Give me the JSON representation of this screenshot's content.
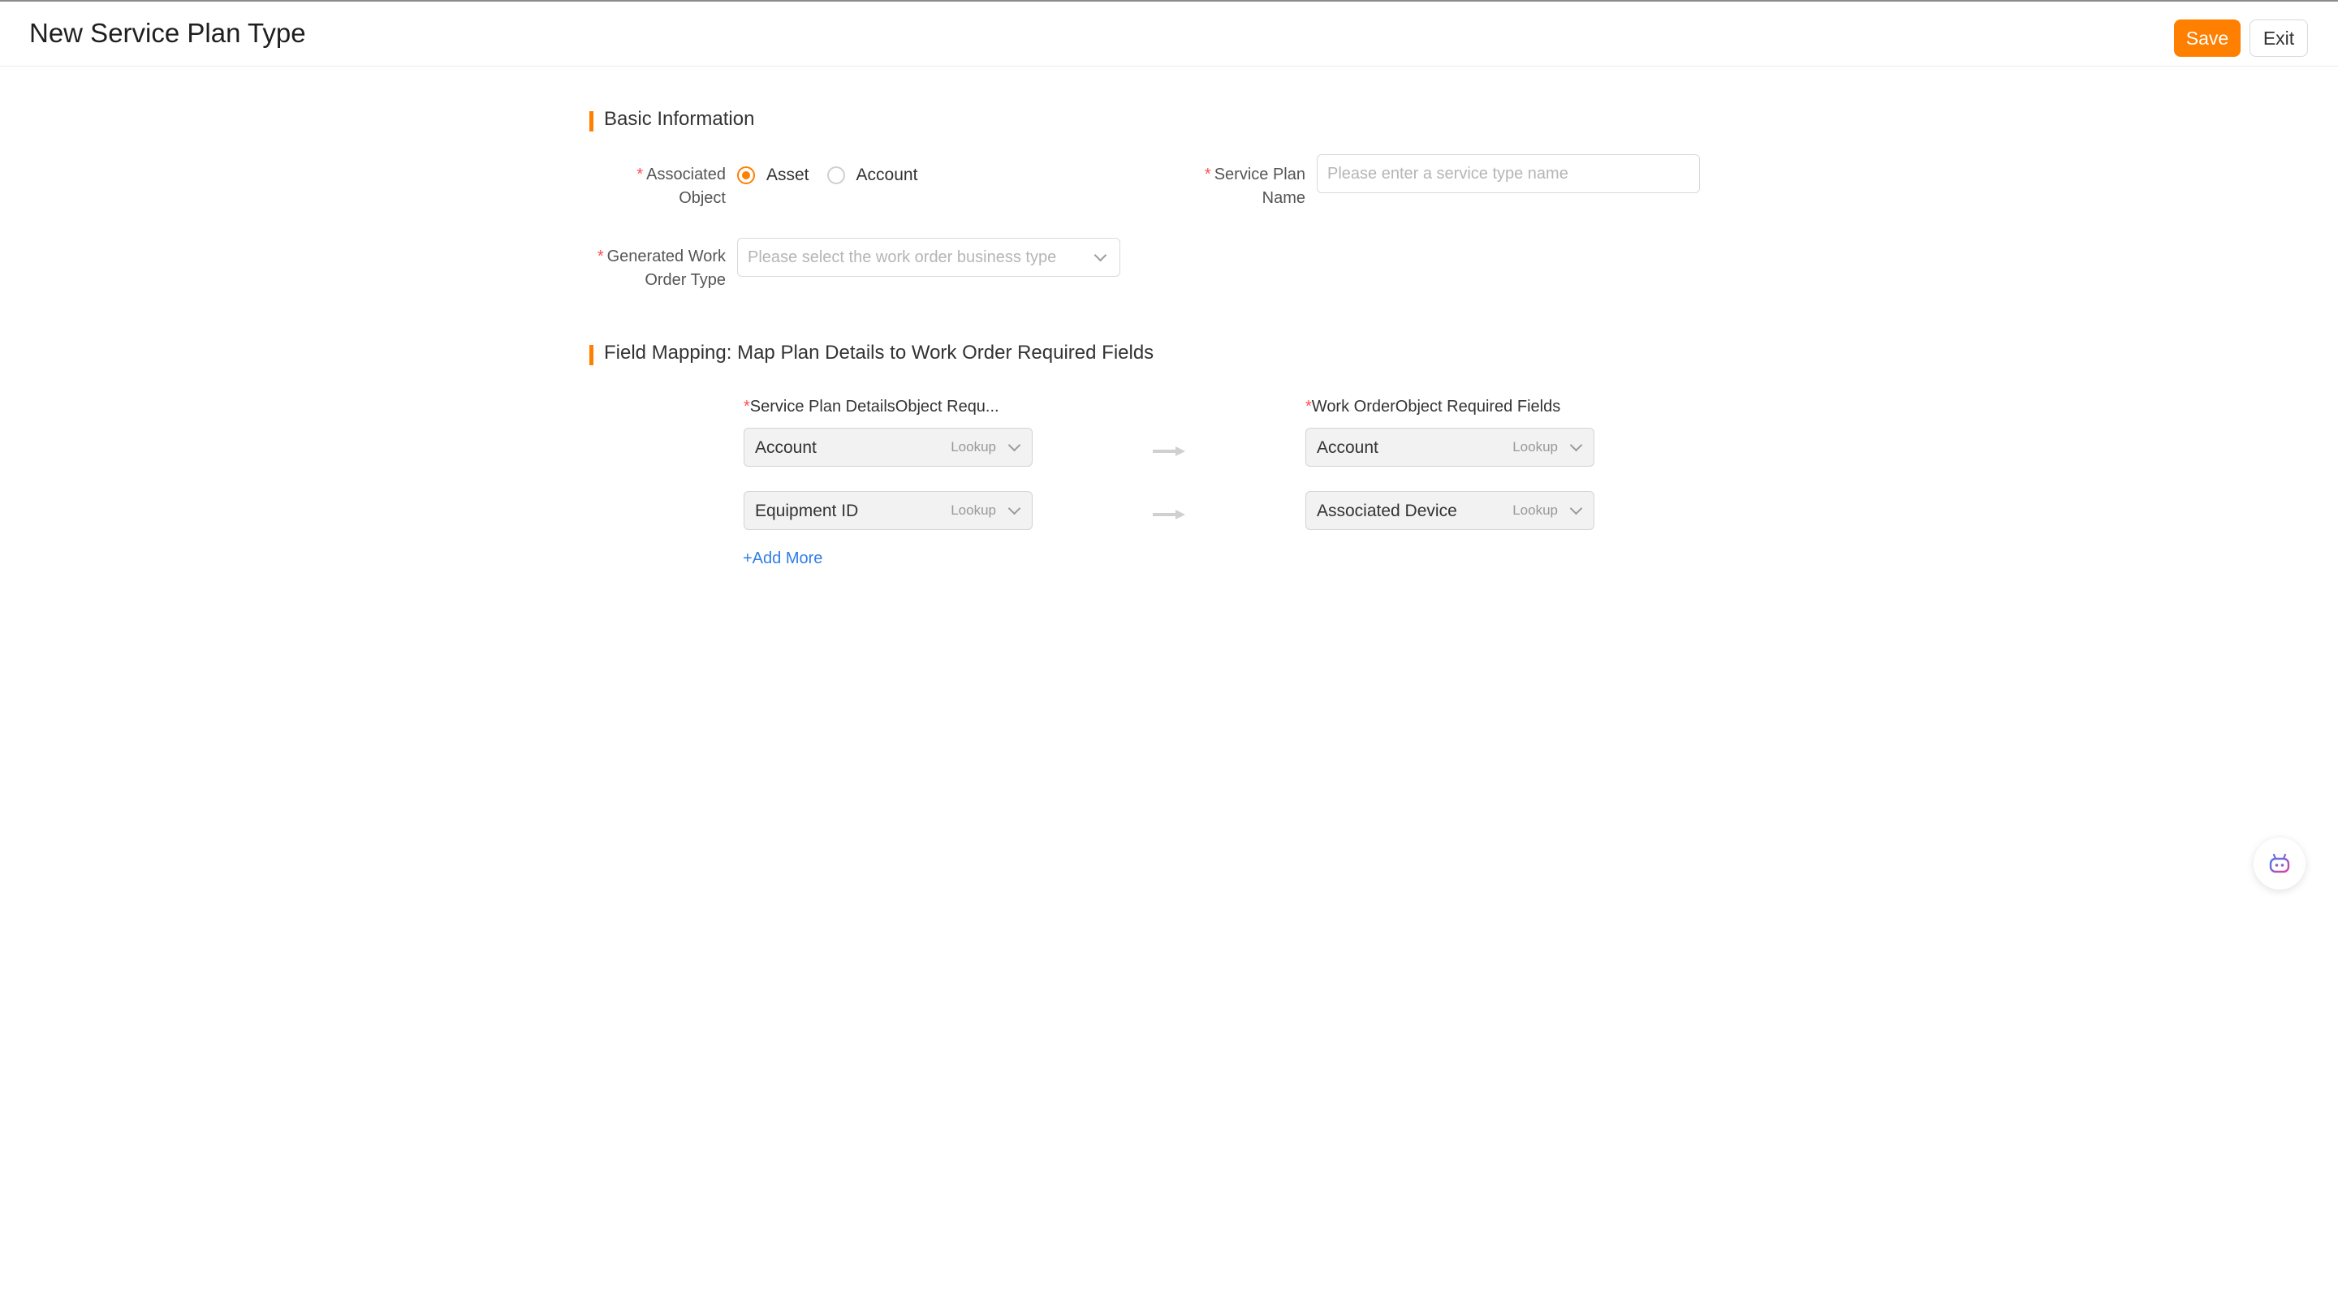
{
  "header": {
    "title": "New Service Plan Type",
    "save_label": "Save",
    "exit_label": "Exit"
  },
  "basic_info": {
    "section_title": "Basic Information",
    "associated_object": {
      "label_line1": "Associated",
      "label_line2": "Object",
      "options": [
        "Asset",
        "Account"
      ],
      "selected": "Asset"
    },
    "service_plan_name": {
      "label_line1": "Service Plan",
      "label_line2": "Name",
      "placeholder": "Please enter a service type name",
      "value": ""
    },
    "work_order_type": {
      "label_line1": "Generated Work",
      "label_line2": "Order Type",
      "placeholder": "Please select the work order business type"
    }
  },
  "field_mapping": {
    "section_title": "Field Mapping: Map Plan Details to Work Order Required Fields",
    "left_header": "Service Plan DetailsObject Requ...",
    "right_header": "Work OrderObject Required Fields",
    "rows": [
      {
        "left_field": "Account",
        "left_type": "Lookup",
        "right_field": "Account",
        "right_type": "Lookup"
      },
      {
        "left_field": "Equipment ID",
        "left_type": "Lookup",
        "right_field": "Associated Device",
        "right_type": "Lookup"
      }
    ],
    "add_more_label": "+Add More"
  },
  "colors": {
    "accent": "#ff7f00",
    "required": "#ff4d4f",
    "link": "#2f7ee8"
  },
  "icons": {
    "assistant": "robot-assistant-icon",
    "arrow": "right-arrow-icon",
    "dropdown": "chevron-down-icon"
  }
}
